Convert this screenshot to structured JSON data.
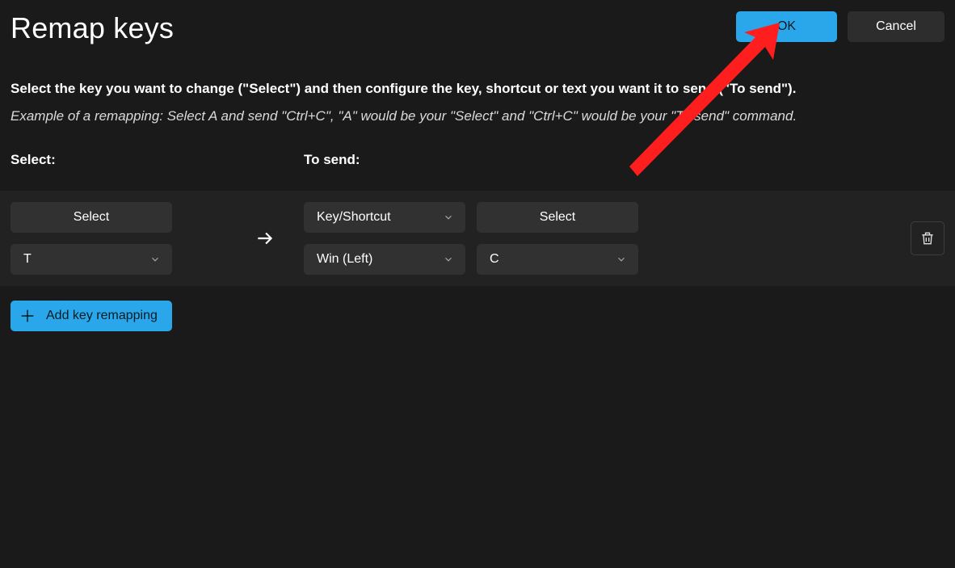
{
  "title": "Remap keys",
  "buttons": {
    "ok": "OK",
    "cancel": "Cancel"
  },
  "description": "Select the key you want to change (\"Select\") and then configure the key, shortcut or text you want it to send (\"To send\").",
  "example": "Example of a remapping: Select A and send \"Ctrl+C\", \"A\" would be your \"Select\" and \"Ctrl+C\" would be your \"To send\" command.",
  "columns": {
    "select": "Select:",
    "to_send": "To send:"
  },
  "row": {
    "select_button": "Select",
    "select_value": "T",
    "type_value": "Key/Shortcut",
    "to_send_select_button": "Select",
    "modifier_value": "Win (Left)",
    "key_value": "C"
  },
  "add_button": "Add key remapping"
}
